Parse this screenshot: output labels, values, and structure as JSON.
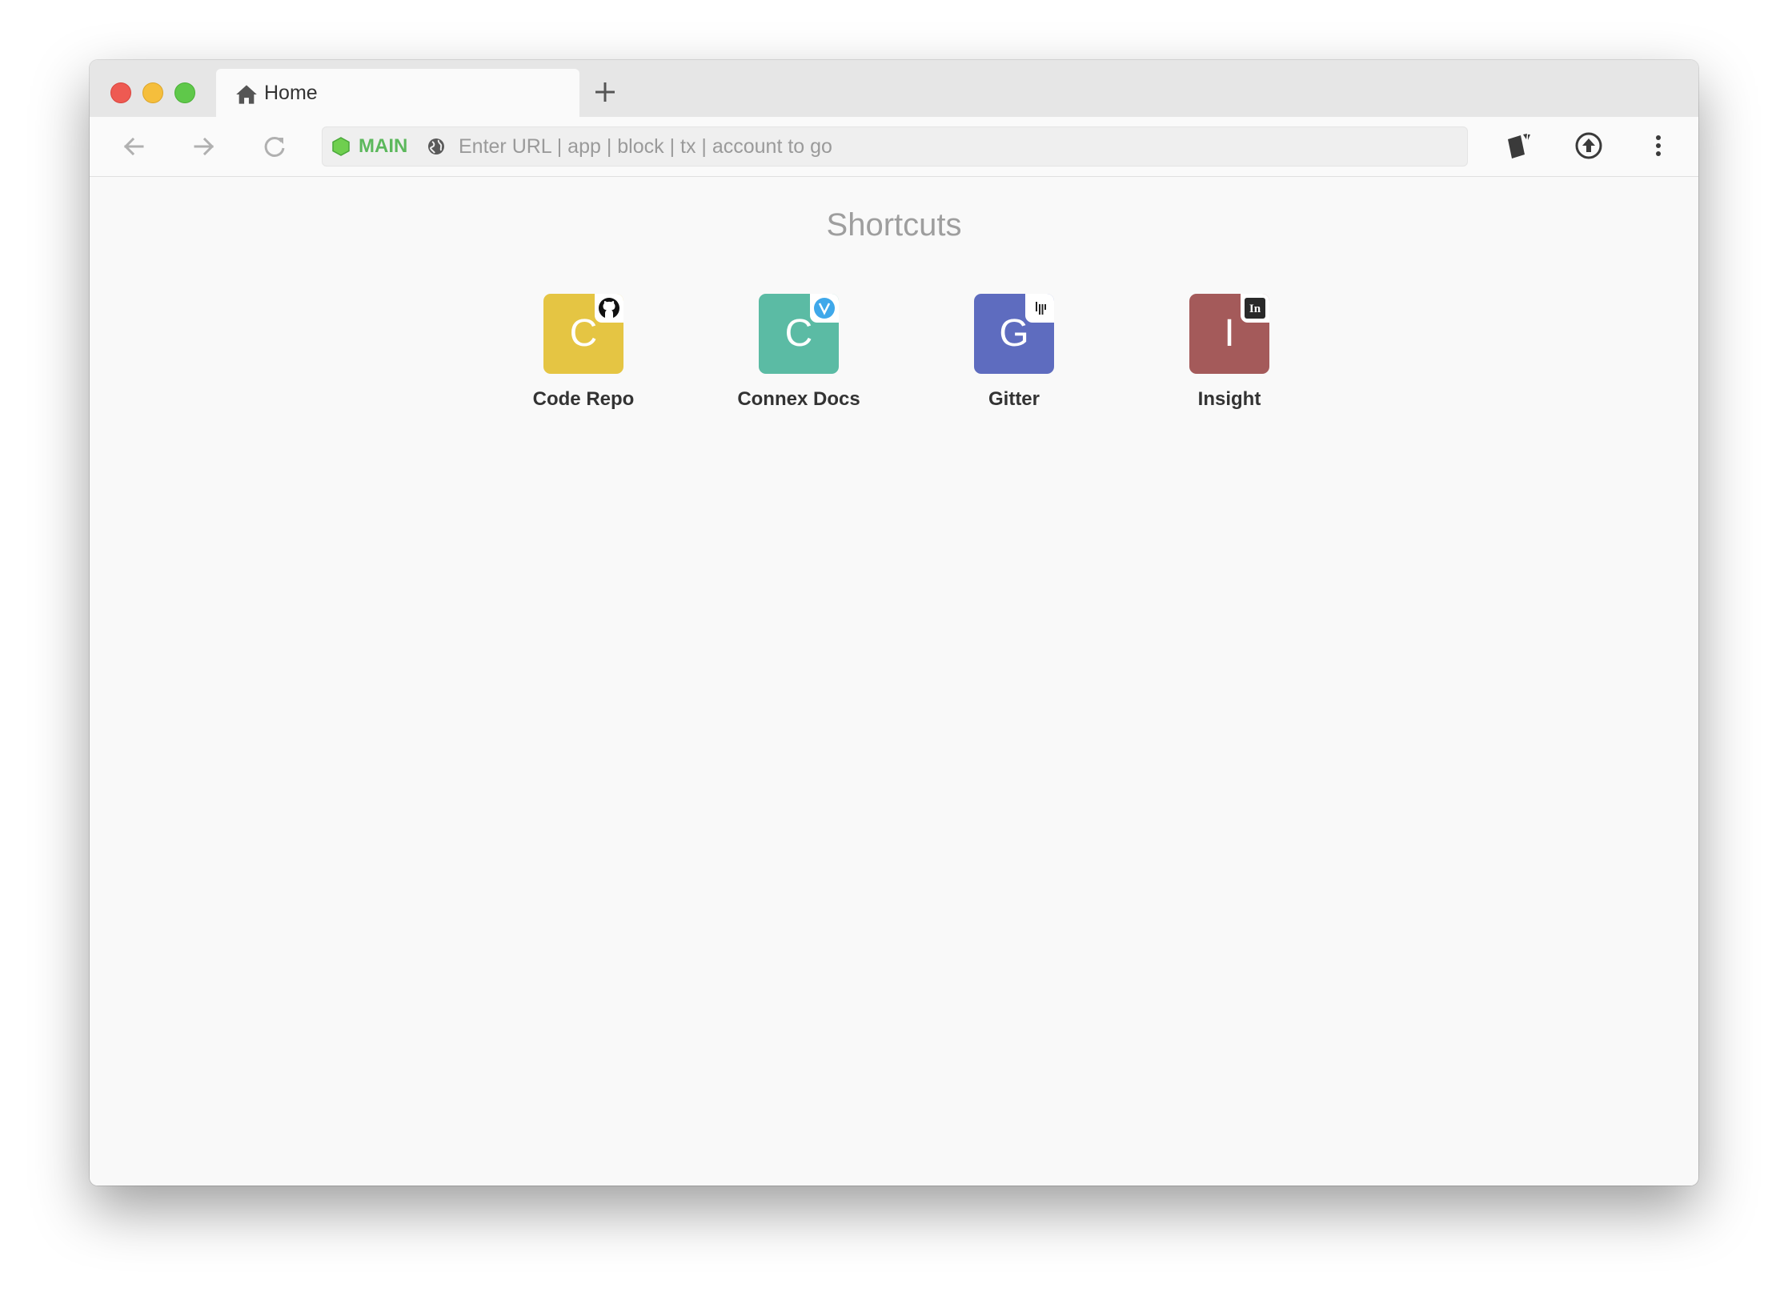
{
  "tabs": [
    {
      "label": "Home",
      "icon": "home-icon"
    }
  ],
  "toolbar": {
    "network_label": "MAIN",
    "network_color": "#5cb85c",
    "url_placeholder": "Enter URL | app | block | tx | account to go",
    "url_value": ""
  },
  "content": {
    "title": "Shortcuts",
    "shortcuts": [
      {
        "letter": "C",
        "label": "Code Repo",
        "color": "#e5c543",
        "badge_icon": "github-icon"
      },
      {
        "letter": "C",
        "label": "Connex Docs",
        "color": "#5bbba4",
        "badge_icon": "vuepress-icon"
      },
      {
        "letter": "G",
        "label": "Gitter",
        "color": "#5e6cbf",
        "badge_icon": "gitter-icon"
      },
      {
        "letter": "I",
        "label": "Insight",
        "color": "#a45a5a",
        "badge_icon": "insight-icon"
      }
    ]
  }
}
